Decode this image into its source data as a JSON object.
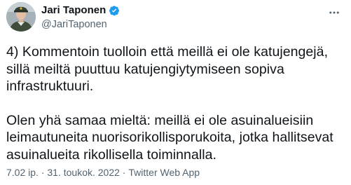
{
  "author": {
    "display_name": "Jari Taponen",
    "handle": "@JariTaponen",
    "verified_icon": "verified-badge-icon",
    "avatar_icon": "profile-photo"
  },
  "more_icon": "more-horizontal-icon",
  "tweet": {
    "paragraphs": [
      "4) Kommentoin tuolloin että meillä ei ole katujengejä,\nsillä meiltä puuttuu katujengiytymiseen sopiva\ninfrastruktuuri.",
      "Olen yhä samaa mieltä: meillä ei ole asuinalueisiin\nleimautuneita nuorisorikollisporukoita, jotka hallitsevat\nasuinalueita rikollisella toiminnalla."
    ]
  },
  "meta": {
    "time": "7.02 ip.",
    "separator": " · ",
    "date": "31. toukok. 2022",
    "source": "Twitter Web App"
  },
  "colors": {
    "text": "#0f1419",
    "secondary": "#536471",
    "verified": "#1d9bf0"
  }
}
